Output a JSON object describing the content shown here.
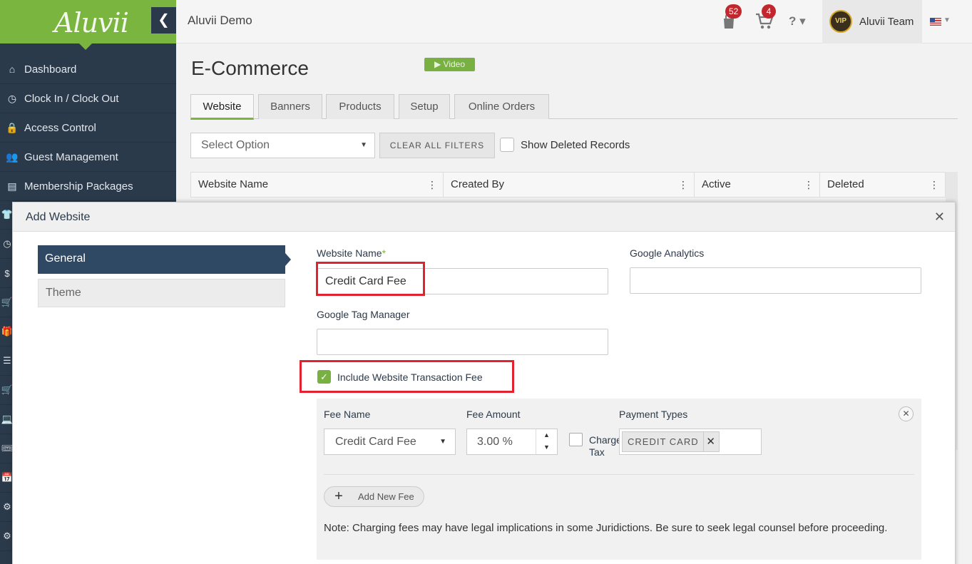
{
  "app": {
    "logo": "Aluvii",
    "title": "Aluvii Demo",
    "collapse_glyph": "❮"
  },
  "header": {
    "badge_bag": "52",
    "badge_cart": "4",
    "help_glyph": "? ▾",
    "user_name": "Aluvii Team",
    "avatar_text": "VIP"
  },
  "sidebar": {
    "items": [
      {
        "label": "Dashboard",
        "icon": "home-icon",
        "glyph": "⌂"
      },
      {
        "label": "Clock In / Clock Out",
        "icon": "clock-icon",
        "glyph": "◷"
      },
      {
        "label": "Access Control",
        "icon": "lock-icon",
        "glyph": "🔒"
      },
      {
        "label": "Guest Management",
        "icon": "users-icon",
        "glyph": "👥"
      },
      {
        "label": "Membership Packages",
        "icon": "card-icon",
        "glyph": "▤"
      }
    ],
    "more_icons": [
      {
        "icon": "shirt-icon",
        "glyph": "👕"
      },
      {
        "icon": "clock2-icon",
        "glyph": "◷"
      },
      {
        "icon": "dollar-icon",
        "glyph": "$"
      },
      {
        "icon": "cart-icon",
        "glyph": "🛒"
      },
      {
        "icon": "gift-icon",
        "glyph": "🎁"
      },
      {
        "icon": "list-icon",
        "glyph": "☰"
      },
      {
        "icon": "cart2-icon",
        "glyph": "🛒"
      },
      {
        "icon": "laptop-icon",
        "glyph": "💻"
      },
      {
        "icon": "ticket-icon",
        "glyph": "🎟"
      },
      {
        "icon": "calendar-icon",
        "glyph": "📅"
      },
      {
        "icon": "gear-icon",
        "glyph": "⚙"
      },
      {
        "icon": "gears-icon",
        "glyph": "⚙"
      }
    ]
  },
  "page": {
    "title": "E-Commerce",
    "video_label": "▶ Video",
    "tabs": [
      "Website",
      "Banners",
      "Products",
      "Setup",
      "Online Orders"
    ],
    "select_placeholder": "Select Option",
    "clear_filters": "CLEAR ALL FILTERS",
    "show_deleted": "Show Deleted Records",
    "columns": [
      "Website Name",
      "Created By",
      "Active",
      "Deleted"
    ],
    "column_menu_glyph": "⋮"
  },
  "modal": {
    "title": "Add Website",
    "close_glyph": "✕",
    "side_tabs": [
      "General",
      "Theme"
    ],
    "website_name_label": "Website Name",
    "required_mark": "*",
    "website_name_value": "Credit Card Fee",
    "google_analytics_label": "Google Analytics",
    "google_analytics_value": "",
    "google_tag_label": "Google Tag Manager",
    "google_tag_value": "",
    "include_fee_label": "Include Website Transaction Fee",
    "include_fee_checked": true,
    "fee": {
      "fee_name_label": "Fee Name",
      "fee_amount_label": "Fee Amount",
      "payment_types_label": "Payment Types",
      "fee_name_value": "Credit Card Fee",
      "fee_amount_value": "3.00 %",
      "charge_tax_label_1": "Charge",
      "charge_tax_label_2": "Tax",
      "payment_type_tag": "CREDIT CARD",
      "remove_tag_glyph": "✕",
      "remove_fee_glyph": "✕",
      "add_fee_plus": "+",
      "add_fee_label": "Add New Fee",
      "note": "Note: Charging fees may have legal implications in some Juridictions. Be sure to seek legal counsel before proceeding."
    }
  },
  "colors": {
    "brand_green": "#7ab540",
    "sidebar": "#2b3a4a",
    "highlight_red": "#e0232f",
    "badge_red": "#c1272d"
  }
}
